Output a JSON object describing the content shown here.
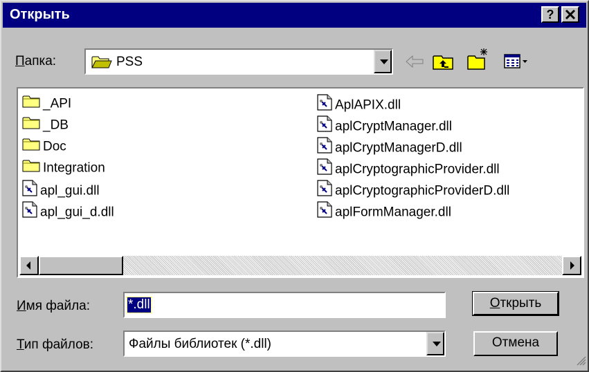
{
  "dialog": {
    "title": "Открыть",
    "help_button": "?",
    "close_button": "✕"
  },
  "folder": {
    "label": "Папка:",
    "label_hotkey": "П",
    "label_rest": "апка:",
    "value": "PSS"
  },
  "files": [
    {
      "name": "_API",
      "type": "folder"
    },
    {
      "name": "_DB",
      "type": "folder"
    },
    {
      "name": "Doc",
      "type": "folder"
    },
    {
      "name": "Integration",
      "type": "folder"
    },
    {
      "name": "apl_gui.dll",
      "type": "dll"
    },
    {
      "name": "apl_gui_d.dll",
      "type": "dll"
    },
    {
      "name": "AplAPIX.dll",
      "type": "dll"
    },
    {
      "name": "aplCryptManager.dll",
      "type": "dll"
    },
    {
      "name": "aplCryptManagerD.dll",
      "type": "dll"
    },
    {
      "name": "aplCryptographicProvider.dll",
      "type": "dll"
    },
    {
      "name": "aplCryptographicProviderD.dll",
      "type": "dll"
    },
    {
      "name": "aplFormManager.dll",
      "type": "dll"
    }
  ],
  "filename": {
    "label_hotkey": "И",
    "label_rest": "мя файла:",
    "value": "*.dll"
  },
  "filetype": {
    "label_hotkey": "Т",
    "label_rest": "ип файлов:",
    "value": "Файлы библиотек (*.dll)"
  },
  "buttons": {
    "open_hotkey": "О",
    "open_rest": "ткрыть",
    "cancel": "Отмена"
  },
  "colors": {
    "titlebar": "#000080",
    "face": "#c0c0c0",
    "selection": "#000080"
  }
}
